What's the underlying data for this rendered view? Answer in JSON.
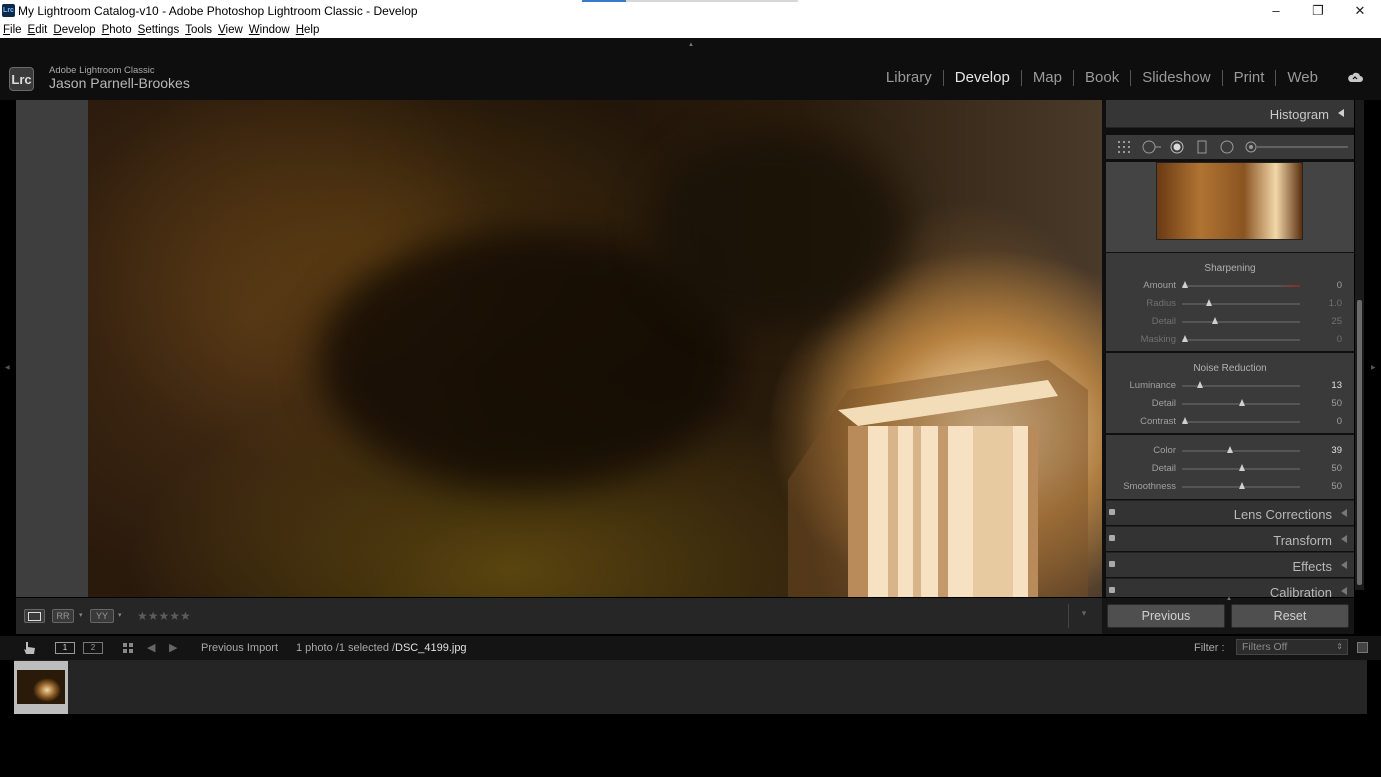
{
  "window": {
    "title": "My Lightroom Catalog-v10 - Adobe Photoshop Lightroom Classic - Develop",
    "app_icon": "Lrc",
    "controls": [
      "–",
      "❐",
      "✕"
    ]
  },
  "menu": [
    "File",
    "Edit",
    "Develop",
    "Photo",
    "Settings",
    "Tools",
    "View",
    "Window",
    "Help"
  ],
  "identity": {
    "badge": "Lrc",
    "product": "Adobe Lightroom Classic",
    "user": "Jason Parnell-Brookes"
  },
  "modules": {
    "library": "Library",
    "develop": "Develop",
    "map": "Map",
    "book": "Book",
    "slideshow": "Slideshow",
    "print": "Print",
    "web": "Web"
  },
  "right_panel": {
    "histogram_label": "Histogram",
    "sharpening": {
      "title": "Sharpening",
      "sliders": [
        {
          "label": "Amount",
          "value": "0",
          "pos": 0.0
        },
        {
          "label": "Radius",
          "value": "1.0",
          "pos": 0.22
        },
        {
          "label": "Detail",
          "value": "25",
          "pos": 0.27
        },
        {
          "label": "Masking",
          "value": "0",
          "pos": 0.0
        }
      ]
    },
    "noise_reduction": {
      "title": "Noise Reduction",
      "sliders": [
        {
          "label": "Luminance",
          "value": "13",
          "pos": 0.13
        },
        {
          "label": "Detail",
          "value": "50",
          "pos": 0.5
        },
        {
          "label": "Contrast",
          "value": "0",
          "pos": 0.0
        }
      ],
      "color_sliders": [
        {
          "label": "Color",
          "value": "39",
          "pos": 0.39
        },
        {
          "label": "Detail",
          "value": "50",
          "pos": 0.5
        },
        {
          "label": "Smoothness",
          "value": "50",
          "pos": 0.5
        }
      ]
    },
    "collapsed_sections": {
      "lens": "Lens Corrections",
      "transform": "Transform",
      "effects": "Effects",
      "calibration": "Calibration"
    },
    "previous_button": "Previous",
    "reset_button": "Reset"
  },
  "toolbar": {
    "view_modes": [
      "",
      "RR",
      "YY"
    ],
    "stars": "★★★★★"
  },
  "filmstrip": {
    "view1": "1",
    "view2": "2",
    "source": "Previous Import",
    "count": "1 photo /1 selected /",
    "filename": "DSC_4199.jpg",
    "filter_label": "Filter :",
    "filter_value": "Filters Off"
  },
  "colors": {
    "panel_bg": "#3a3a3a",
    "active_module": "#e6e6e6",
    "inactive_module": "#9a9a9a"
  }
}
